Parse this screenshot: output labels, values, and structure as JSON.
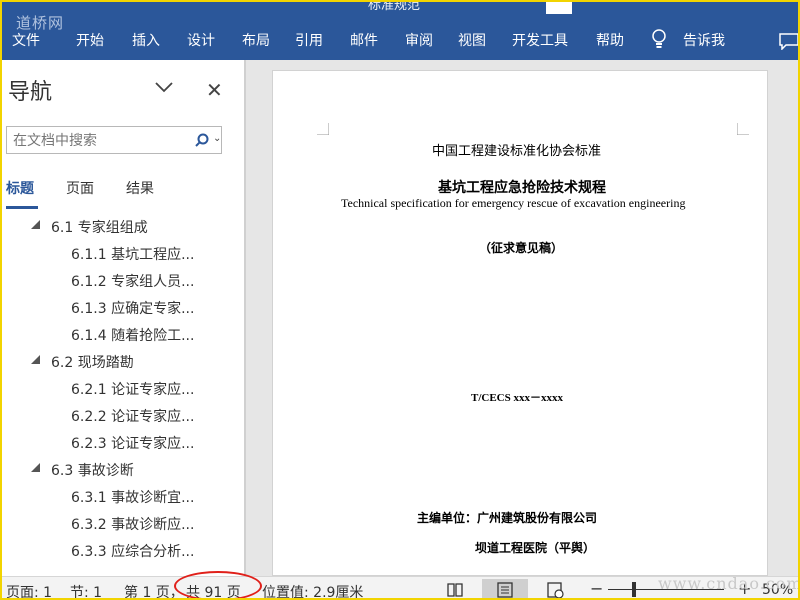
{
  "ribbon": {
    "title_hint": "标准规范",
    "logo": "道桥网",
    "tabs": [
      "文件",
      "开始",
      "插入",
      "设计",
      "布局",
      "引用",
      "邮件",
      "审阅",
      "视图",
      "开发工具",
      "帮助",
      "告诉我"
    ]
  },
  "nav": {
    "title": "导航",
    "search_placeholder": "在文档中搜索",
    "tabs": [
      "标题",
      "页面",
      "结果"
    ],
    "items": [
      {
        "label": "6.1 专家组组成",
        "level": 1
      },
      {
        "label": "6.1.1 基坑工程应...",
        "level": 2
      },
      {
        "label": "6.1.2 专家组人员...",
        "level": 2
      },
      {
        "label": "6.1.3 应确定专家...",
        "level": 2
      },
      {
        "label": "6.1.4 随着抢险工...",
        "level": 2
      },
      {
        "label": "6.2 现场踏勘",
        "level": 1
      },
      {
        "label": "6.2.1 论证专家应...",
        "level": 2
      },
      {
        "label": "6.2.2 论证专家应...",
        "level": 2
      },
      {
        "label": "6.2.3 论证专家应...",
        "level": 2
      },
      {
        "label": "6.3 事故诊断",
        "level": 1
      },
      {
        "label": "6.3.1 事故诊断宜...",
        "level": 2
      },
      {
        "label": "6.3.2 事故诊断应...",
        "level": 2
      },
      {
        "label": "6.3.3 应综合分析...",
        "level": 2
      }
    ]
  },
  "document": {
    "org_line": "中国工程建设标准化协会标准",
    "title_cn": "基坑工程应急抢险技术规程",
    "title_en": "Technical specification for emergency rescue of excavation engineering",
    "draft": "（征求意见稿）",
    "code": "T/CECS xxx－xxxx",
    "chief_unit_label": "主编单位：",
    "chief_unit": "广州建筑股份有限公司",
    "second_unit": "坝道工程医院（平舆）"
  },
  "status": {
    "page": "页面: 1",
    "section": "节: 1",
    "page_of": "第 1 页，",
    "total": "共 91 页",
    "position": "位置值: 2.9厘米",
    "zoom": "50%"
  },
  "watermark": "www.cndao.com",
  "colors": {
    "ribbon": "#2b579a",
    "highlight_circle": "#e0201a",
    "frame": "#f2d400"
  }
}
